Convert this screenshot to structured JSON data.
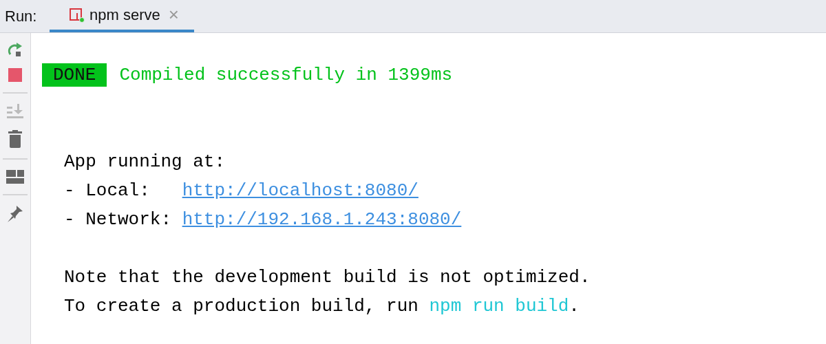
{
  "run_bar": {
    "label": "Run:",
    "tabs": [
      {
        "label": "npm serve",
        "selected": true,
        "close": "×"
      }
    ]
  },
  "toolbar": [
    {
      "kind": "rerun",
      "disabled": false
    },
    {
      "kind": "stop",
      "disabled": false
    },
    {
      "kind": "separator"
    },
    {
      "kind": "scroll-end",
      "disabled": true
    },
    {
      "kind": "trash",
      "disabled": false
    },
    {
      "kind": "separator"
    },
    {
      "kind": "layout",
      "disabled": false
    },
    {
      "kind": "separator"
    },
    {
      "kind": "pin",
      "disabled": false
    }
  ],
  "console": {
    "status": {
      "badge": "DONE",
      "message": "Compiled successfully in 1399ms"
    },
    "blocks": [
      {
        "lines": [
          {
            "segments": [
              {
                "kind": "text",
                "text": "App running at:"
              }
            ]
          },
          {
            "segments": [
              {
                "kind": "label",
                "text": "- Local:"
              },
              {
                "kind": "link",
                "text": "http://localhost:8080/"
              }
            ]
          },
          {
            "segments": [
              {
                "kind": "label",
                "text": "- Network:"
              },
              {
                "kind": "link",
                "text": "http://192.168.1.243:8080/"
              }
            ]
          }
        ]
      },
      {
        "lines": [
          {
            "segments": [
              {
                "kind": "text",
                "text": "Note that the development build is not optimized."
              }
            ]
          },
          {
            "segments": [
              {
                "kind": "text",
                "text": "To create a production build, run"
              },
              {
                "kind": "command",
                "text": "npm run build"
              },
              {
                "kind": "text",
                "text": "."
              }
            ]
          }
        ]
      }
    ]
  }
}
